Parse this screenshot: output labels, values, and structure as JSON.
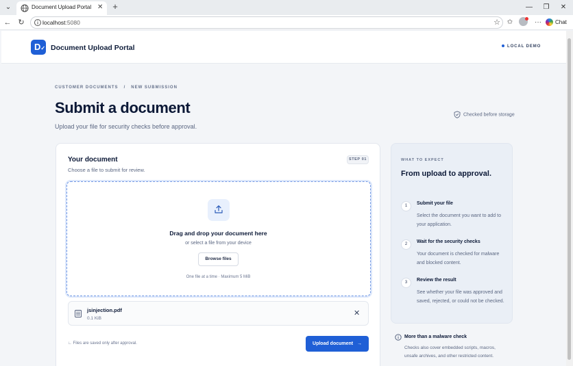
{
  "browser": {
    "tab_title": "Document Upload Portal",
    "url_host": "localhost",
    "url_port": ":5080",
    "chat_label": "Chat"
  },
  "header": {
    "logo_letter": "D",
    "brand": "Document Upload Portal",
    "demo_label": "LOCAL DEMO",
    "accent_color": "#1f5fd6"
  },
  "breadcrumb": {
    "items": [
      "CUSTOMER DOCUMENTS",
      "NEW SUBMISSION"
    ],
    "separator": "/"
  },
  "page": {
    "title": "Submit a document",
    "subtitle": "Upload your file for security checks before approval.",
    "checked_label": "Checked before storage"
  },
  "upload_card": {
    "title": "Your document",
    "subtitle": "Choose a file to submit for review.",
    "step_badge": "STEP 01",
    "drop_title": "Drag and drop your document here",
    "drop_sub": "or select a file from your device",
    "browse_label": "Browse files",
    "limit_text": "One file at a time · Maximum 5 MiB",
    "file": {
      "name": "jsinjection.pdf",
      "size": "0.1 KiB"
    },
    "footnote": "Files are saved only after approval.",
    "upload_label": "Upload document",
    "upload_arrow": "→"
  },
  "expect": {
    "eyebrow": "WHAT TO EXPECT",
    "title": "From upload to approval.",
    "steps": [
      {
        "num": "1",
        "title": "Submit your file",
        "desc": "Select the document you want to add to your application."
      },
      {
        "num": "2",
        "title": "Wait for the security checks",
        "desc": "Your document is checked for malware and blocked content."
      },
      {
        "num": "3",
        "title": "Review the result",
        "desc": "See whether your file was approved and saved, rejected, or could not be checked."
      }
    ]
  },
  "note": {
    "title": "More than a malware check",
    "text": "Checks also cover embedded scripts, macros, unsafe archives, and other restricted content."
  }
}
